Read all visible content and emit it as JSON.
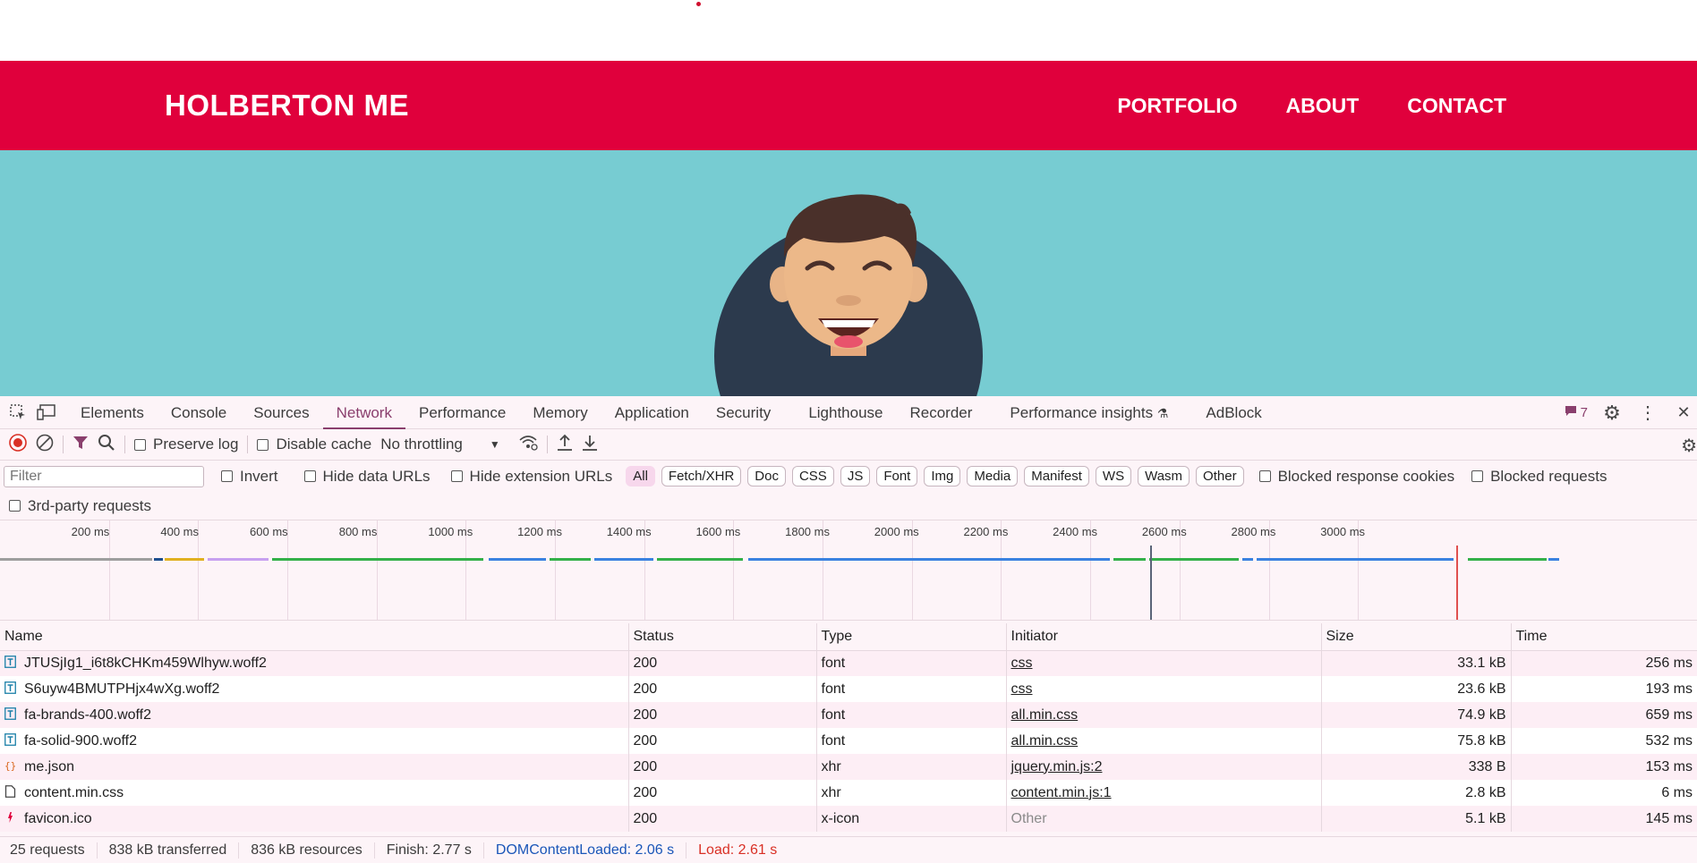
{
  "site": {
    "logo": "HOLBERTON ME",
    "nav": [
      "PORTFOLIO",
      "ABOUT",
      "CONTACT"
    ]
  },
  "devtools": {
    "tabs": [
      "Elements",
      "Console",
      "Sources",
      "Network",
      "Performance",
      "Memory",
      "Application",
      "Security",
      "Lighthouse",
      "Recorder",
      "Performance insights",
      "AdBlock"
    ],
    "active_tab": "Network",
    "issues_count": "7",
    "toolbar": {
      "preserve_log": "Preserve log",
      "disable_cache": "Disable cache",
      "throttling": "No throttling"
    },
    "filter": {
      "placeholder": "Filter",
      "invert": "Invert",
      "hide_data_urls": "Hide data URLs",
      "hide_extension_urls": "Hide extension URLs",
      "types": [
        "All",
        "Fetch/XHR",
        "Doc",
        "CSS",
        "JS",
        "Font",
        "Img",
        "Media",
        "Manifest",
        "WS",
        "Wasm",
        "Other"
      ],
      "active_type": "All",
      "blocked_cookies": "Blocked response cookies",
      "blocked_requests": "Blocked requests",
      "third_party": "3rd-party requests"
    },
    "overview": {
      "ticks": [
        "200 ms",
        "400 ms",
        "600 ms",
        "800 ms",
        "1000 ms",
        "1200 ms",
        "1400 ms",
        "1600 ms",
        "1800 ms",
        "2000 ms",
        "2200 ms",
        "2400 ms",
        "2600 ms",
        "2800 ms",
        "3000 ms"
      ],
      "dom_content_loaded_ms": 2060,
      "load_ms": 2610
    },
    "table": {
      "columns": [
        "Name",
        "Status",
        "Type",
        "Initiator",
        "Size",
        "Time"
      ],
      "rows": [
        {
          "icon": "font",
          "name": "JTUSjIg1_i6t8kCHKm459Wlhyw.woff2",
          "status": "200",
          "type": "font",
          "initiator": "css",
          "initiator_link": true,
          "size": "33.1 kB",
          "time": "256 ms"
        },
        {
          "icon": "font",
          "name": "S6uyw4BMUTPHjx4wXg.woff2",
          "status": "200",
          "type": "font",
          "initiator": "css",
          "initiator_link": true,
          "size": "23.6 kB",
          "time": "193 ms"
        },
        {
          "icon": "font",
          "name": "fa-brands-400.woff2",
          "status": "200",
          "type": "font",
          "initiator": "all.min.css",
          "initiator_link": true,
          "size": "74.9 kB",
          "time": "659 ms"
        },
        {
          "icon": "font",
          "name": "fa-solid-900.woff2",
          "status": "200",
          "type": "font",
          "initiator": "all.min.css",
          "initiator_link": true,
          "size": "75.8 kB",
          "time": "532 ms"
        },
        {
          "icon": "json",
          "name": "me.json",
          "status": "200",
          "type": "xhr",
          "initiator": "jquery.min.js:2",
          "initiator_link": true,
          "size": "338 B",
          "time": "153 ms"
        },
        {
          "icon": "doc",
          "name": "content.min.css",
          "status": "200",
          "type": "xhr",
          "initiator": "content.min.js:1",
          "initiator_link": true,
          "size": "2.8 kB",
          "time": "6 ms"
        },
        {
          "icon": "image",
          "name": "favicon.ico",
          "status": "200",
          "type": "x-icon",
          "initiator": "Other",
          "initiator_link": false,
          "size": "5.1 kB",
          "time": "145 ms"
        }
      ]
    },
    "status": {
      "requests": "25 requests",
      "transferred": "838 kB transferred",
      "resources": "836 kB resources",
      "finish": "Finish: 2.77 s",
      "dcl": "DOMContentLoaded: 2.06 s",
      "load": "Load: 2.61 s"
    }
  }
}
